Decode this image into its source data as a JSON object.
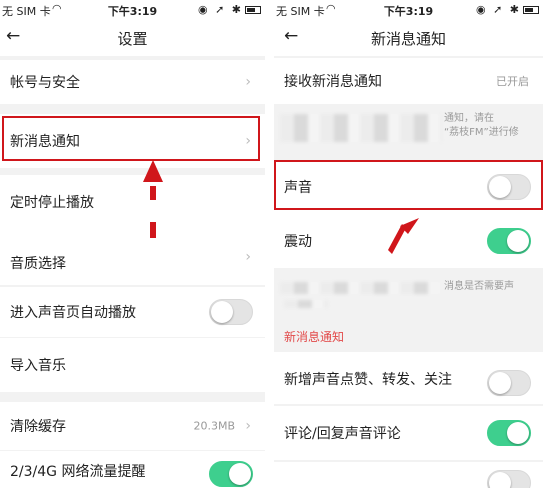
{
  "statusbar": {
    "carrier": "无 SIM 卡",
    "time": "下午3:19"
  },
  "left": {
    "nav_title": "设置",
    "rows": {
      "account": "帐号与安全",
      "notifications": "新消息通知",
      "timer": "定时停止播放",
      "quality": "音质选择",
      "autoplay": "进入声音页自动播放",
      "import_music": "导入音乐",
      "clear_cache": "清除缓存",
      "cache_size": "20.3MB",
      "network": "2/3/4G 网络流量提醒"
    },
    "toggles": {
      "autoplay": false,
      "network": true
    }
  },
  "right": {
    "nav_title": "新消息通知",
    "receive_label": "接收新消息通知",
    "receive_value": "已开启",
    "hint_1_line1": "通知，请在",
    "hint_1_line2": "“荔枝FM”进行修",
    "sound_label": "声音",
    "vibrate_label": "震动",
    "hint_2": "消息是否需要声",
    "section_label": "新消息通知",
    "likes_label": "新增声音点赞、转发、关注",
    "comments_label": "评论/回复声音评论",
    "toggles": {
      "sound": false,
      "vibrate": true,
      "likes": false,
      "comments": true,
      "last": false
    }
  },
  "colors": {
    "highlight": "#d0161b",
    "toggle_on": "#3ecf8e",
    "section": "#e24a4a"
  }
}
